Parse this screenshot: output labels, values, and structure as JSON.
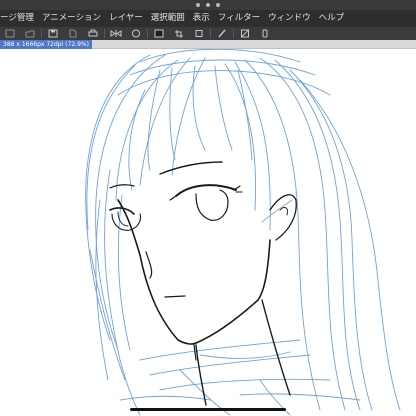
{
  "menubar": {
    "items": [
      {
        "label": "ージ管理"
      },
      {
        "label": "アニメーション"
      },
      {
        "label": "レイヤー"
      },
      {
        "label": "選択範囲"
      },
      {
        "label": "表示"
      },
      {
        "label": "フィルター"
      },
      {
        "label": "ウィンドウ"
      },
      {
        "label": "ヘルプ"
      }
    ]
  },
  "document": {
    "info": "388 x 1666px 72dpi (72.9%)"
  },
  "colors": {
    "menubar_bg": "#2e2e30",
    "toolbar_bg": "#3b3b3d",
    "file_tab": "#4d79c7",
    "sketch_blue": "#6fa3e0",
    "ink_line": "#1a1a1a"
  }
}
